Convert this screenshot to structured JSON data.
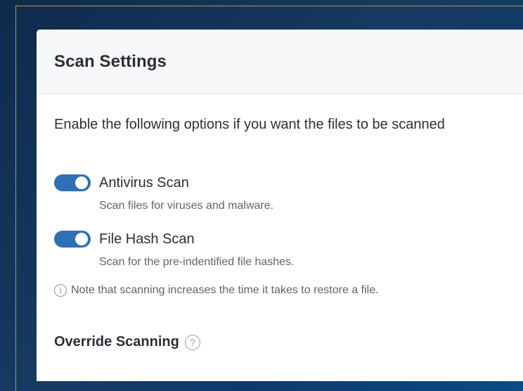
{
  "card": {
    "title": "Scan Settings",
    "intro": "Enable the following options if you want the files to be scanned"
  },
  "options": [
    {
      "label": "Antivirus Scan",
      "description": "Scan files for viruses and malware.",
      "enabled": true
    },
    {
      "label": "File Hash Scan",
      "description": "Scan for the pre-indentified file hashes.",
      "enabled": true
    }
  ],
  "note": {
    "icon": "i",
    "text": "Note that scanning increases the time it takes to restore a file."
  },
  "override": {
    "title": "Override Scanning",
    "help_icon": "?"
  },
  "colors": {
    "toggle_on": "#2f6fb3",
    "frame_border": "#b89a3a"
  }
}
